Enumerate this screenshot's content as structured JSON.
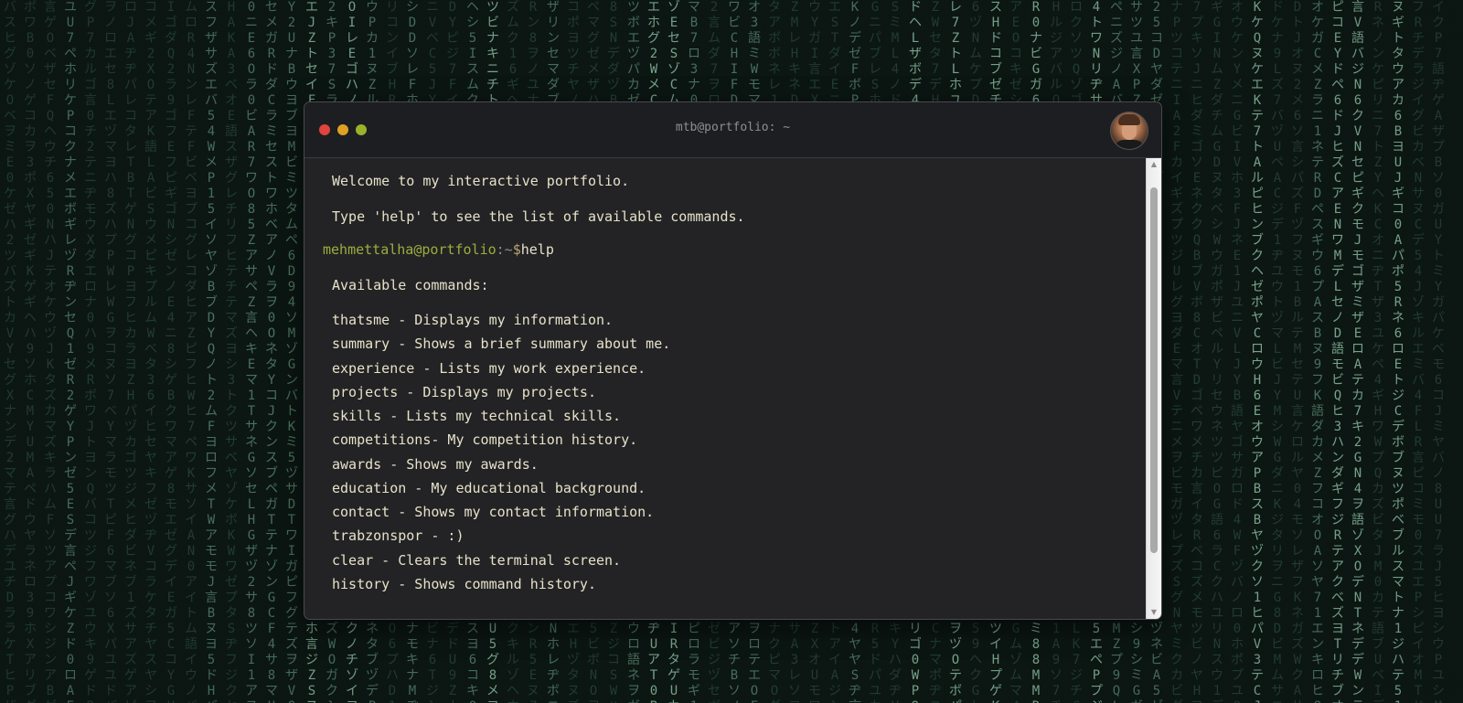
{
  "window": {
    "title": "mtb@portfolio: ~",
    "avatar_icon": "user-avatar-icon"
  },
  "terminal": {
    "intro": [
      "Welcome to my interactive portfolio.",
      "Type 'help' to see the list of available commands."
    ],
    "prompt": {
      "user_host": "mehmettalha@portfolio",
      "separator": ":~",
      "dollar": "$",
      "command": "help"
    },
    "output_heading": "Available commands:",
    "commands": [
      "thatsme - Displays my information.",
      "summary - Shows a brief summary about me.",
      "experience - Lists my work experience.",
      "projects - Displays my projects.",
      "skills - Lists my technical skills.",
      "competitions- My competition history.",
      "awards - Shows my awards.",
      "education - My educational background.",
      "contact - Shows my contact information.",
      "trabzonspor - :)",
      "clear - Clears the terminal screen.",
      "history - Shows command history."
    ]
  },
  "colors": {
    "background": "#0c1714",
    "terminal_bg": "#232325",
    "prompt_user": "#9aae3c",
    "text": "#e7e2c9",
    "dot_red": "#e0443e",
    "dot_yellow": "#dfa123",
    "dot_green": "#9cb12a"
  }
}
